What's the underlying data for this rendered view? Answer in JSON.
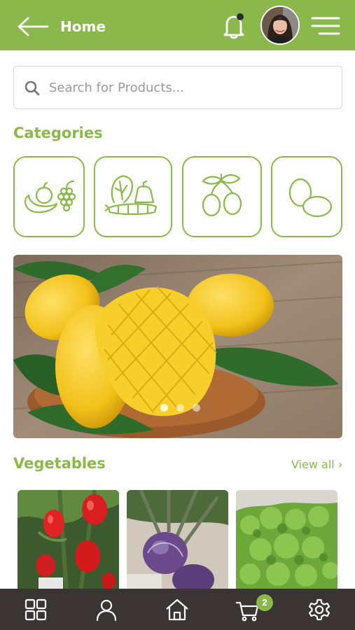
{
  "header": {
    "title": "Home",
    "back_icon": "arrow-left-icon",
    "notification_icon": "bell-icon",
    "menu_icon": "hamburger-icon"
  },
  "search": {
    "placeholder": "Search for Products..."
  },
  "categories": {
    "title": "Categories",
    "items": [
      {
        "icon": "fruits-icon"
      },
      {
        "icon": "vegetables-icon"
      },
      {
        "icon": "olives-icon"
      },
      {
        "icon": "eggs-icon"
      }
    ]
  },
  "banner": {
    "subject": "mangoes",
    "slides": 3,
    "active_slide": 1
  },
  "vegetables": {
    "title": "Vegetables",
    "view_all": "View all ›",
    "products": [
      {
        "subject": "tomatoes"
      },
      {
        "subject": "kohlrabi"
      },
      {
        "subject": "lettuce"
      }
    ]
  },
  "bottom_nav": {
    "items": [
      {
        "icon": "grid-icon"
      },
      {
        "icon": "user-icon"
      },
      {
        "icon": "home-icon"
      },
      {
        "icon": "cart-icon"
      },
      {
        "icon": "gear-icon"
      }
    ],
    "cart_count": "2"
  },
  "colors": {
    "brand": "#8bb84a",
    "nav_bg": "#3a3433"
  }
}
